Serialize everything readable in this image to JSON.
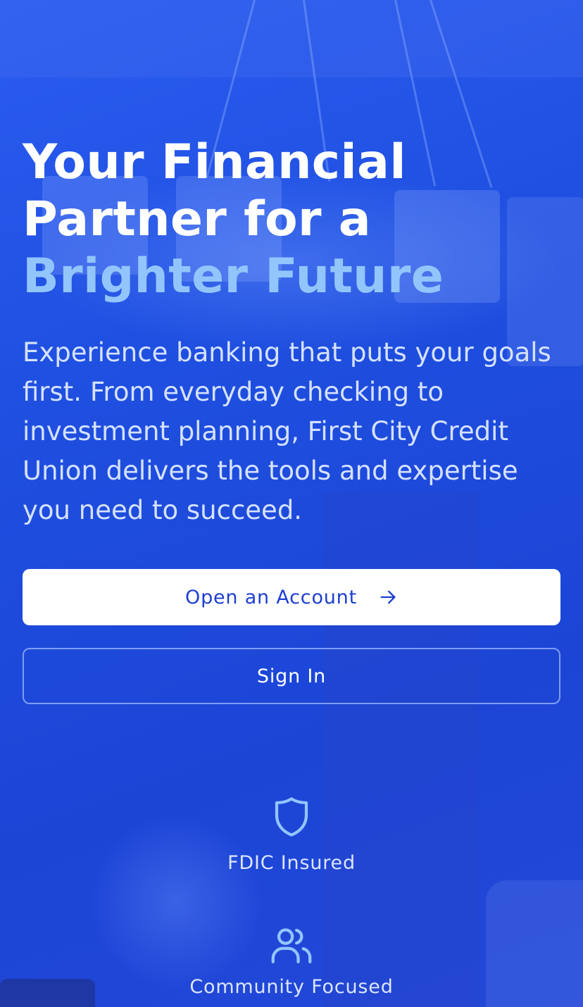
{
  "hero": {
    "headline_line1": "Your Financial",
    "headline_line2": "Partner for a",
    "headline_accent": "Brighter Future",
    "subtext": "Experience banking that puts your goals first. From everyday checking to investment planning, First City Credit Union delivers the tools and expertise you need to succeed."
  },
  "actions": {
    "open_account_label": "Open an Account",
    "open_account_icon": "arrow-right-icon",
    "sign_in_label": "Sign In"
  },
  "features": [
    {
      "label": "FDIC Insured",
      "icon": "shield-icon"
    },
    {
      "label": "Community Focused",
      "icon": "users-icon"
    }
  ],
  "colors": {
    "background": "#2452e0",
    "accent_text": "#93c5fd",
    "primary_button_bg": "#ffffff",
    "primary_button_text": "#1d3fd0",
    "icon": "#93c5fd"
  }
}
